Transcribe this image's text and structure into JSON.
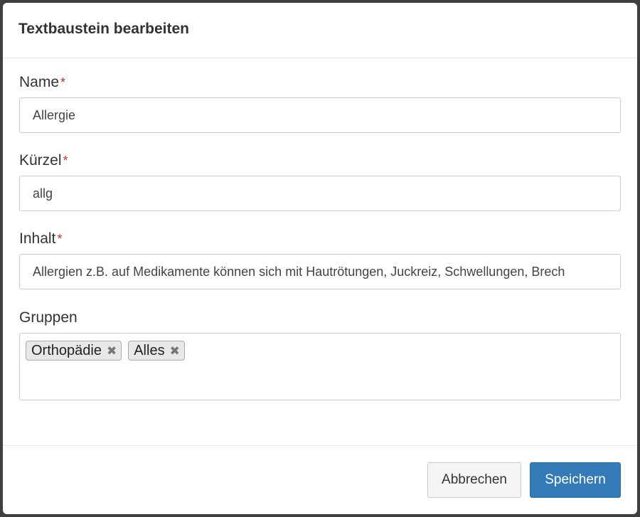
{
  "dialog": {
    "title": "Textbaustein bearbeiten"
  },
  "fields": {
    "name": {
      "label": "Name",
      "required_mark": "*",
      "value": "Allergie"
    },
    "kuerzel": {
      "label": "Kürzel",
      "required_mark": "*",
      "value": "allg"
    },
    "inhalt": {
      "label": "Inhalt",
      "required_mark": "*",
      "value": "Allergien z.B. auf Medikamente können sich mit Hautrötungen, Juckreiz, Schwellungen, Brech"
    },
    "gruppen": {
      "label": "Gruppen",
      "tags": [
        {
          "label": "Orthopädie",
          "remove": "✖"
        },
        {
          "label": "Alles",
          "remove": "✖"
        }
      ]
    }
  },
  "footer": {
    "cancel_label": "Abbrechen",
    "save_label": "Speichern"
  },
  "colors": {
    "primary": "#337ab7",
    "required": "#c9302c"
  }
}
